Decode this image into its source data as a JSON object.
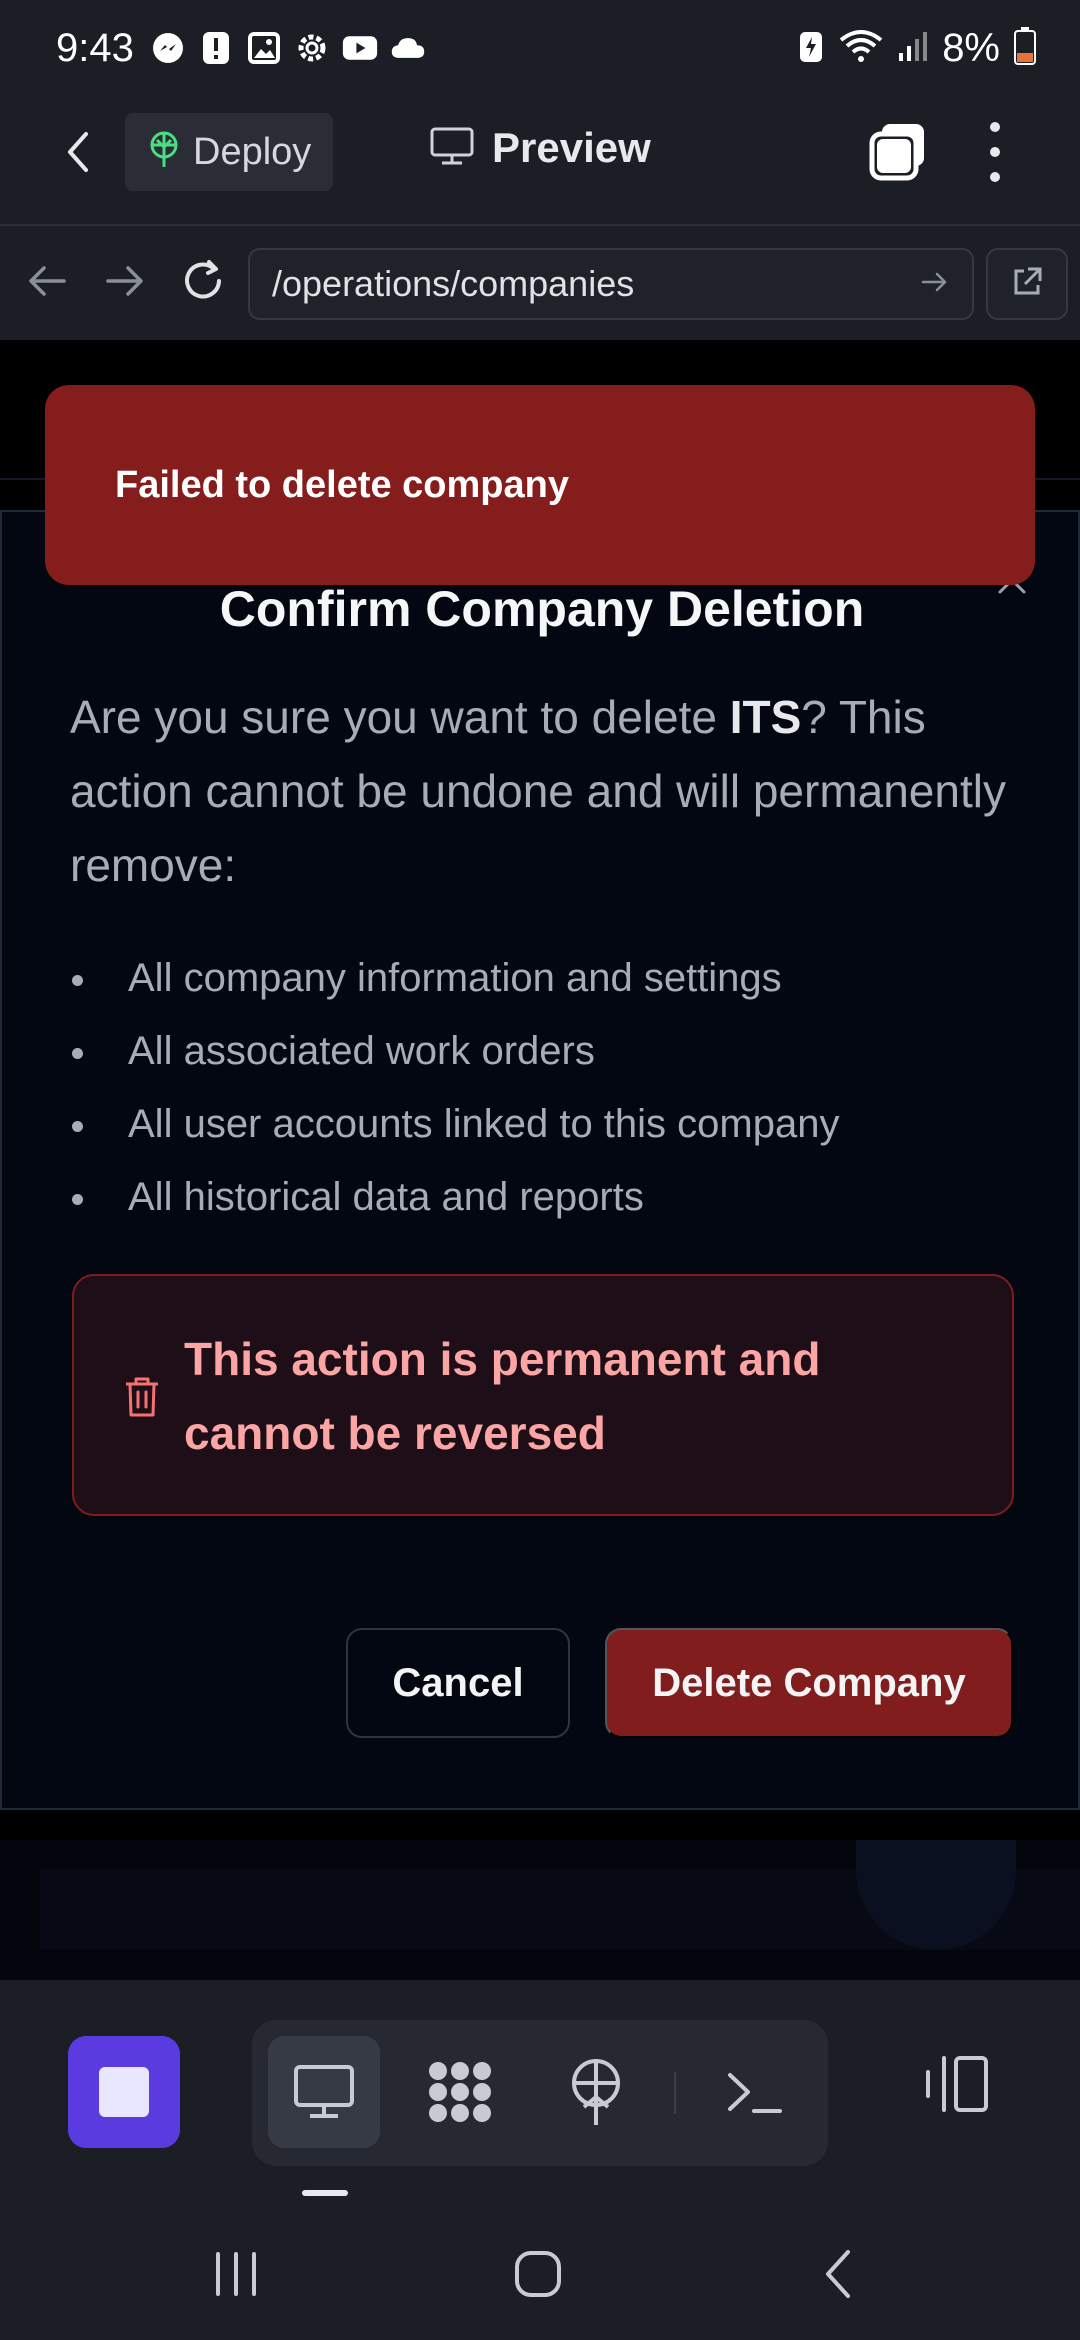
{
  "status_bar": {
    "time": "9:43",
    "battery": "8%",
    "icons": [
      "messenger-icon",
      "alert-icon",
      "gallery-icon",
      "settings-icon",
      "youtube-icon",
      "cloud-icon"
    ],
    "right_icons": [
      "battery-saver-icon",
      "wifi-icon",
      "signal-icon",
      "battery-icon"
    ]
  },
  "app_bar": {
    "deploy_label": "Deploy",
    "preview_label": "Preview"
  },
  "url_bar": {
    "url": "/operations/companies"
  },
  "toast": {
    "message": "Failed to delete company"
  },
  "dialog": {
    "title": "Confirm Company Deletion",
    "message_before": "Are you sure you want to delete ",
    "company_name": "ITS",
    "message_after": "? This action cannot be undone and will permanently remove:",
    "items": [
      "All company information and settings",
      "All associated work orders",
      "All user accounts linked to this company",
      "All historical data and reports"
    ],
    "warning": "This action is permanent and cannot be reversed",
    "cancel_label": "Cancel",
    "delete_label": "Delete Company"
  },
  "toolbar": {
    "tools": [
      "desktop-icon",
      "grid-dots-icon",
      "deploy-icon",
      "terminal-icon"
    ],
    "active_tool": "desktop-icon"
  },
  "colors": {
    "toast_bg": "#861d1d",
    "delete_button_bg": "#811d1d",
    "warning_text": "#fca5a5",
    "accent_purple": "#5a3be0"
  }
}
